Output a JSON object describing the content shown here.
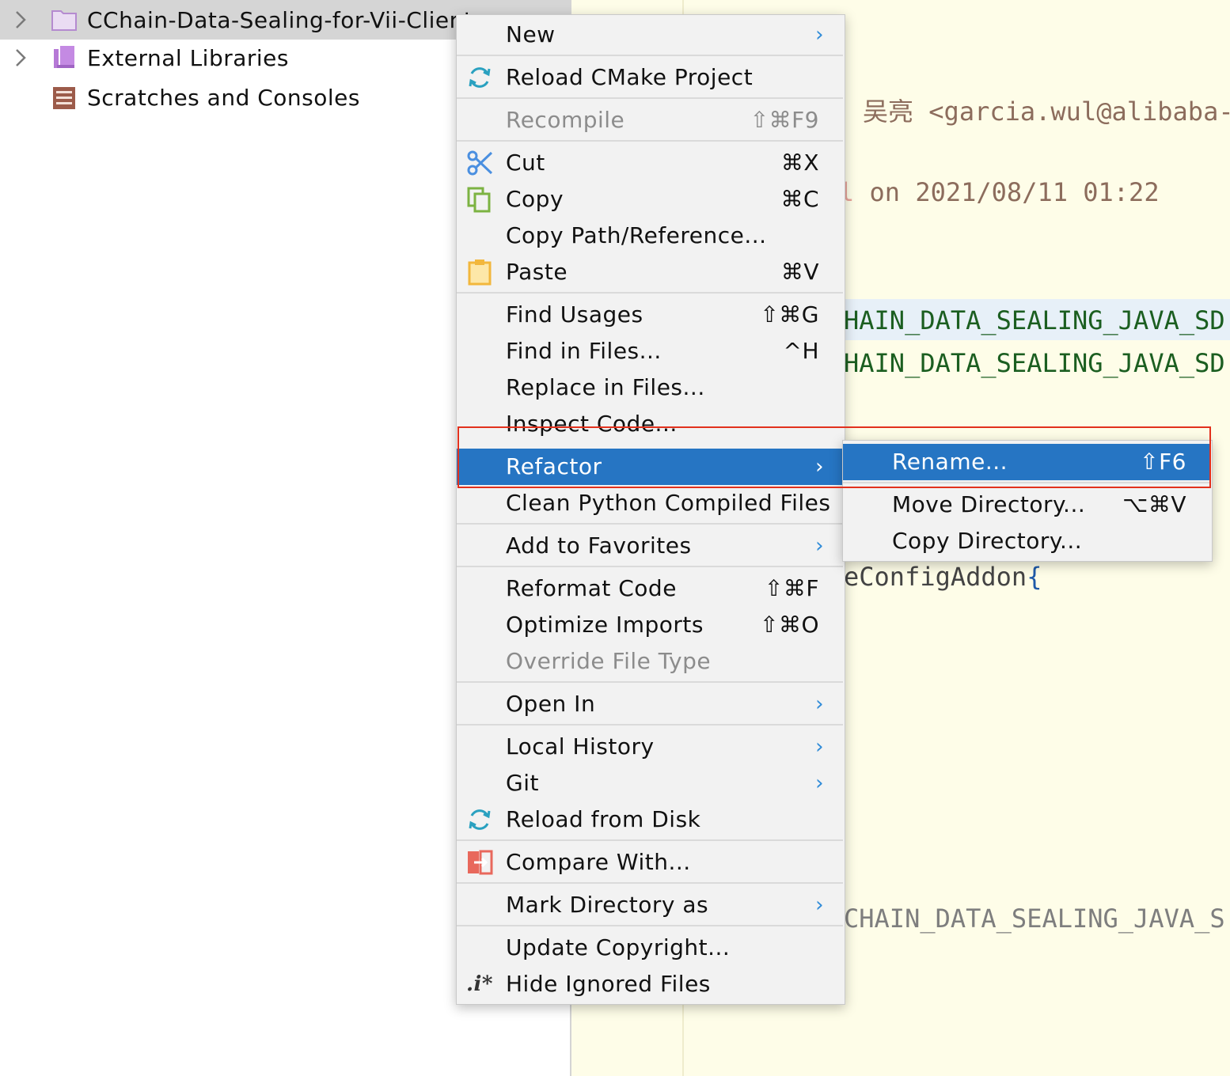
{
  "project_tree": [
    {
      "label": "CChain-Data-Sealing-for-Vii-Client",
      "expandable": true,
      "selected": true,
      "icon": "folder-icon"
    },
    {
      "label": "External Libraries",
      "expandable": true,
      "selected": false,
      "icon": "library-icon"
    },
    {
      "label": "Scratches and Consoles",
      "expandable": false,
      "selected": false,
      "icon": "scratches-icon"
    }
  ],
  "editor": {
    "author_name": "吴亮",
    "author_email": "<garcia.wul@alibaba-",
    "created_prefix": "l",
    "created_text": "on 2021/08/11 01:22",
    "line_sd1": "HAIN_DATA_SEALING_JAVA_SD",
    "line_sd2": "HAIN_DATA_SEALING_JAVA_SD",
    "line_config": "eConfigAddon",
    "line_config_brace": "{",
    "line_s": "CHAIN_DATA_SEALING_JAVA_S"
  },
  "context_menu": {
    "new": {
      "label": "New",
      "submenu_arrow": "›"
    },
    "reload_cmake": {
      "label": "Reload CMake Project"
    },
    "recompile": {
      "label": "Recompile",
      "shortcut": "⇧⌘F9",
      "disabled": true
    },
    "cut": {
      "label": "Cut",
      "shortcut": "⌘X"
    },
    "copy": {
      "label": "Copy",
      "shortcut": "⌘C"
    },
    "copy_path": {
      "label": "Copy Path/Reference..."
    },
    "paste": {
      "label": "Paste",
      "shortcut": "⌘V"
    },
    "find_usages": {
      "label": "Find Usages",
      "shortcut": "⇧⌘G"
    },
    "find_in_files": {
      "label": "Find in Files...",
      "shortcut": "^H"
    },
    "replace_in_files": {
      "label": "Replace in Files..."
    },
    "inspect_code": {
      "label": "Inspect Code..."
    },
    "refactor": {
      "label": "Refactor",
      "submenu_arrow": "›",
      "active": true
    },
    "clean_python": {
      "label": "Clean Python Compiled Files"
    },
    "add_favorites": {
      "label": "Add to Favorites",
      "submenu_arrow": "›"
    },
    "reformat": {
      "label": "Reformat Code",
      "shortcut": "⇧⌘F"
    },
    "optimize": {
      "label": "Optimize Imports",
      "shortcut": "⇧⌘O"
    },
    "override_type": {
      "label": "Override File Type",
      "disabled": true
    },
    "open_in": {
      "label": "Open In",
      "submenu_arrow": "›"
    },
    "local_history": {
      "label": "Local History",
      "submenu_arrow": "›"
    },
    "git": {
      "label": "Git",
      "submenu_arrow": "›"
    },
    "reload_disk": {
      "label": "Reload from Disk"
    },
    "compare": {
      "label": "Compare With..."
    },
    "mark_dir": {
      "label": "Mark Directory as",
      "submenu_arrow": "›"
    },
    "update_copyright": {
      "label": "Update Copyright..."
    },
    "hide_ignored": {
      "label": "Hide Ignored Files",
      "icon_text": ".i*"
    }
  },
  "refactor_submenu": {
    "rename": {
      "label": "Rename...",
      "shortcut": "⇧F6",
      "active": true
    },
    "move_dir": {
      "label": "Move Directory...",
      "shortcut": "⌥⌘V"
    },
    "copy_dir": {
      "label": "Copy Directory..."
    }
  },
  "colors": {
    "menu_bg": "#f2f2f2",
    "active_bg": "#2675c3",
    "highlight_box": "#e2311d",
    "editor_bg": "#fefde8",
    "comment": "#8c6c5c",
    "string_green": "#1b5e20"
  }
}
